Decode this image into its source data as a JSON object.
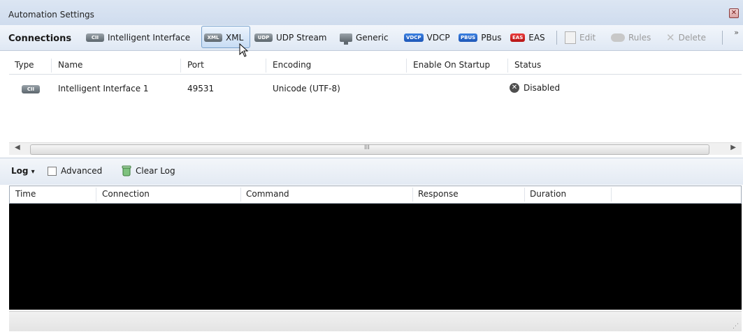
{
  "window": {
    "title": "Automation Settings"
  },
  "toolbar": {
    "connections_label": "Connections",
    "items": [
      {
        "label": "Intelligent Interface",
        "badge": "CII"
      },
      {
        "label": "XML",
        "badge": "XML"
      },
      {
        "label": "UDP Stream",
        "badge": "UDP"
      },
      {
        "label": "Generic",
        "badge": ""
      },
      {
        "label": "VDCP",
        "badge": "VDCP"
      },
      {
        "label": "PBus",
        "badge": "PBUS"
      },
      {
        "label": "EAS",
        "badge": "EAS"
      }
    ],
    "edit_label": "Edit",
    "rules_label": "Rules",
    "delete_label": "Delete",
    "more_glyph": "»"
  },
  "connections_table": {
    "columns": [
      "Type",
      "Name",
      "Port",
      "Encoding",
      "Enable On Startup",
      "Status"
    ],
    "rows": [
      {
        "type_badge": "CII",
        "name": "Intelligent Interface 1",
        "port": "49531",
        "encoding": "Unicode (UTF-8)",
        "enable_on_startup": "",
        "status": "Disabled"
      }
    ]
  },
  "scrollbar": {
    "grip": "III"
  },
  "log": {
    "label": "Log",
    "dropdown_glyph": "▾",
    "advanced_label": "Advanced",
    "clear_label": "Clear Log",
    "columns": [
      "Time",
      "Connection",
      "Command",
      "Response",
      "Duration"
    ]
  },
  "colors": {
    "accent_blue": "#1e57b8",
    "eas_red": "#b51212",
    "log_background": "#000000"
  }
}
